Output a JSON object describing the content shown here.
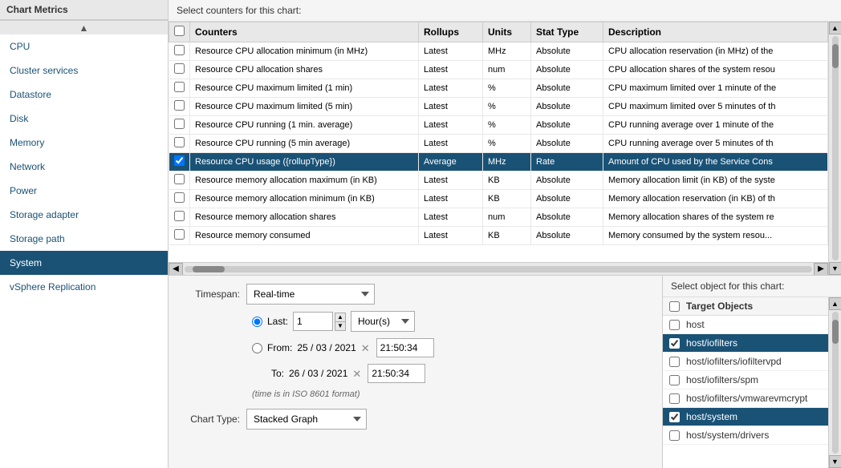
{
  "sidebar": {
    "header": "Chart Metrics",
    "items": [
      {
        "label": "CPU",
        "id": "cpu",
        "active": false
      },
      {
        "label": "Cluster services",
        "id": "cluster-services",
        "active": false
      },
      {
        "label": "Datastore",
        "id": "datastore",
        "active": false
      },
      {
        "label": "Disk",
        "id": "disk",
        "active": false
      },
      {
        "label": "Memory",
        "id": "memory",
        "active": false
      },
      {
        "label": "Network",
        "id": "network",
        "active": false
      },
      {
        "label": "Power",
        "id": "power",
        "active": false
      },
      {
        "label": "Storage adapter",
        "id": "storage-adapter",
        "active": false
      },
      {
        "label": "Storage path",
        "id": "storage-path",
        "active": false
      },
      {
        "label": "System",
        "id": "system",
        "active": true
      },
      {
        "label": "vSphere Replication",
        "id": "vsphere-replication",
        "active": false
      }
    ]
  },
  "counters": {
    "section_title": "Select counters for this chart:",
    "columns": [
      "Counters",
      "Rollups",
      "Units",
      "Stat Type",
      "Description"
    ],
    "rows": [
      {
        "selected": false,
        "counter": "Resource CPU allocation minimum (in MHz)",
        "rollups": "Latest",
        "units": "MHz",
        "stat_type": "Absolute",
        "description": "CPU allocation reservation (in MHz) of the"
      },
      {
        "selected": false,
        "counter": "Resource CPU allocation shares",
        "rollups": "Latest",
        "units": "num",
        "stat_type": "Absolute",
        "description": "CPU allocation shares of the system resou"
      },
      {
        "selected": false,
        "counter": "Resource CPU maximum limited (1 min)",
        "rollups": "Latest",
        "units": "%",
        "stat_type": "Absolute",
        "description": "CPU maximum limited over 1 minute of the"
      },
      {
        "selected": false,
        "counter": "Resource CPU maximum limited (5 min)",
        "rollups": "Latest",
        "units": "%",
        "stat_type": "Absolute",
        "description": "CPU maximum limited over 5 minutes of th"
      },
      {
        "selected": false,
        "counter": "Resource CPU running (1 min. average)",
        "rollups": "Latest",
        "units": "%",
        "stat_type": "Absolute",
        "description": "CPU running average over 1 minute of the"
      },
      {
        "selected": false,
        "counter": "Resource CPU running (5 min average)",
        "rollups": "Latest",
        "units": "%",
        "stat_type": "Absolute",
        "description": "CPU running average over 5 minutes of th"
      },
      {
        "selected": true,
        "counter": "Resource CPU usage ({rollupType})",
        "rollups": "Average",
        "units": "MHz",
        "stat_type": "Rate",
        "description": "Amount of CPU used by the Service Cons"
      },
      {
        "selected": false,
        "counter": "Resource memory allocation maximum (in KB)",
        "rollups": "Latest",
        "units": "KB",
        "stat_type": "Absolute",
        "description": "Memory allocation limit (in KB) of the syste"
      },
      {
        "selected": false,
        "counter": "Resource memory allocation minimum (in KB)",
        "rollups": "Latest",
        "units": "KB",
        "stat_type": "Absolute",
        "description": "Memory allocation reservation (in KB) of th"
      },
      {
        "selected": false,
        "counter": "Resource memory allocation shares",
        "rollups": "Latest",
        "units": "num",
        "stat_type": "Absolute",
        "description": "Memory allocation shares of the system re"
      },
      {
        "selected": false,
        "counter": "Resource memory consumed",
        "rollups": "Latest",
        "units": "KB",
        "stat_type": "Absolute",
        "description": "Memory consumed by the system resou..."
      }
    ]
  },
  "timespan": {
    "label": "Timespan:",
    "value": "Real-time",
    "last_label": "Last:",
    "last_value": "1",
    "unit_value": "Hour(s)",
    "from_label": "From:",
    "from_date": "25 / 03 / 2021",
    "from_time": "21:50:34",
    "to_label": "To:",
    "to_date": "26 / 03 / 2021",
    "to_time": "21:50:34",
    "iso_note": "(time is in ISO 8601 format)"
  },
  "chart_type": {
    "label": "Chart Type:",
    "value": "Stacked Graph"
  },
  "objects": {
    "section_title": "Select object for this chart:",
    "header": "Target Objects",
    "items": [
      {
        "label": "host",
        "selected": false
      },
      {
        "label": "host/iofilters",
        "selected": true
      },
      {
        "label": "host/iofilters/iofiltervpd",
        "selected": false
      },
      {
        "label": "host/iofilters/spm",
        "selected": false
      },
      {
        "label": "host/iofilters/vmwarevmcrypt",
        "selected": false
      },
      {
        "label": "host/system",
        "selected": true
      },
      {
        "label": "host/system/drivers",
        "selected": false
      }
    ]
  }
}
